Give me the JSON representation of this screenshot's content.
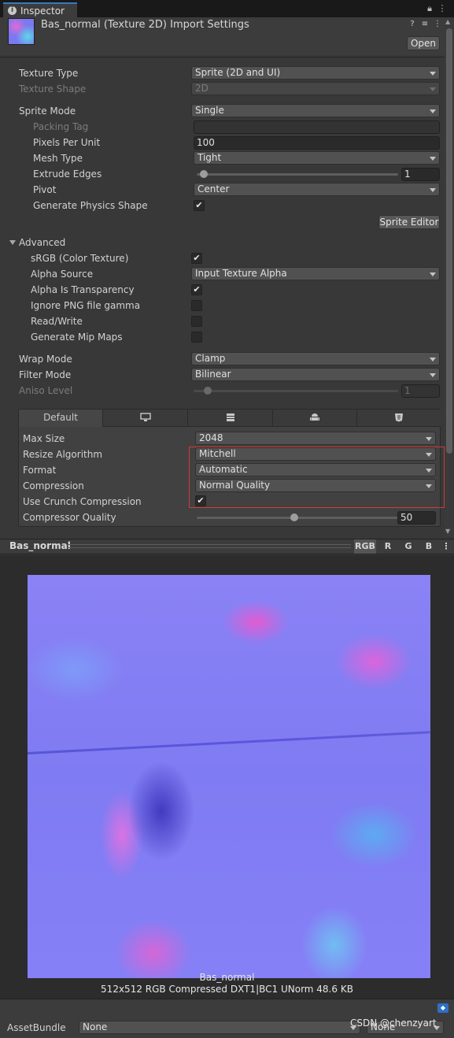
{
  "tab": {
    "label": "Inspector"
  },
  "header": {
    "title": "Bas_normal (Texture 2D) Import Settings",
    "open_label": "Open"
  },
  "texture": {
    "type_label": "Texture Type",
    "type_value": "Sprite (2D and UI)",
    "shape_label": "Texture Shape",
    "shape_value": "2D"
  },
  "sprite": {
    "mode_label": "Sprite Mode",
    "mode_value": "Single",
    "packing_tag_label": "Packing Tag",
    "packing_tag_value": "",
    "ppu_label": "Pixels Per Unit",
    "ppu_value": "100",
    "mesh_type_label": "Mesh Type",
    "mesh_type_value": "Tight",
    "extrude_label": "Extrude Edges",
    "extrude_value": "1",
    "pivot_label": "Pivot",
    "pivot_value": "Center",
    "physics_label": "Generate Physics Shape",
    "physics_checked": true,
    "editor_button": "Sprite Editor"
  },
  "advanced": {
    "label": "Advanced",
    "srgb_label": "sRGB (Color Texture)",
    "srgb_checked": true,
    "alpha_source_label": "Alpha Source",
    "alpha_source_value": "Input Texture Alpha",
    "alpha_transp_label": "Alpha Is Transparency",
    "alpha_transp_checked": true,
    "png_gamma_label": "Ignore PNG file gamma",
    "png_gamma_checked": false,
    "rw_label": "Read/Write",
    "rw_checked": false,
    "mip_label": "Generate Mip Maps",
    "mip_checked": false
  },
  "sampling": {
    "wrap_label": "Wrap Mode",
    "wrap_value": "Clamp",
    "filter_label": "Filter Mode",
    "filter_value": "Bilinear",
    "aniso_label": "Aniso Level",
    "aniso_value": "1"
  },
  "platform": {
    "tabs": [
      "Default",
      "standalone-icon",
      "server-icon",
      "android-icon",
      "webgl-icon"
    ],
    "max_size_label": "Max Size",
    "max_size_value": "2048",
    "resize_label": "Resize Algorithm",
    "resize_value": "Mitchell",
    "format_label": "Format",
    "format_value": "Automatic",
    "compression_label": "Compression",
    "compression_value": "Normal Quality",
    "crunch_label": "Use Crunch Compression",
    "crunch_checked": true,
    "quality_label": "Compressor Quality",
    "quality_value": "50"
  },
  "preview": {
    "title": "Bas_normal",
    "channels": [
      "RGB",
      "R",
      "G",
      "B"
    ],
    "active_channel": "RGB",
    "name": "Bas_normal",
    "info": "512x512  RGB Compressed DXT1|BC1 UNorm   48.6 KB"
  },
  "bottom": {
    "assetbundle_label": "AssetBundle",
    "assetbundle_value": "None",
    "variant_value": "None",
    "watermark": "CSDN @chenzyart"
  },
  "colors": {
    "highlight_box": "#d03a3a",
    "tab_accent": "#3a79bb"
  }
}
